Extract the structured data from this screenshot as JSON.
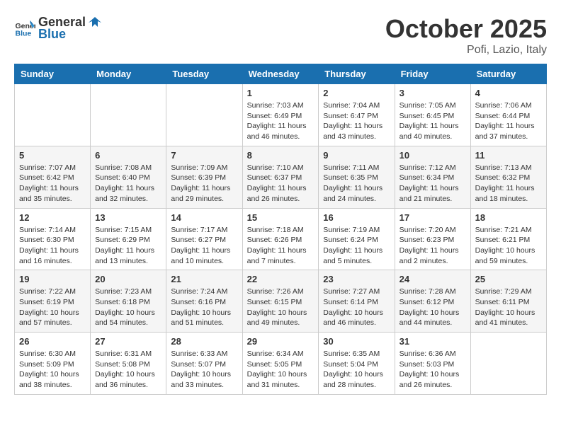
{
  "header": {
    "logo_general": "General",
    "logo_blue": "Blue",
    "month": "October 2025",
    "location": "Pofi, Lazio, Italy"
  },
  "weekdays": [
    "Sunday",
    "Monday",
    "Tuesday",
    "Wednesday",
    "Thursday",
    "Friday",
    "Saturday"
  ],
  "weeks": [
    [
      {
        "day": "",
        "info": ""
      },
      {
        "day": "",
        "info": ""
      },
      {
        "day": "",
        "info": ""
      },
      {
        "day": "1",
        "info": "Sunrise: 7:03 AM\nSunset: 6:49 PM\nDaylight: 11 hours and 46 minutes."
      },
      {
        "day": "2",
        "info": "Sunrise: 7:04 AM\nSunset: 6:47 PM\nDaylight: 11 hours and 43 minutes."
      },
      {
        "day": "3",
        "info": "Sunrise: 7:05 AM\nSunset: 6:45 PM\nDaylight: 11 hours and 40 minutes."
      },
      {
        "day": "4",
        "info": "Sunrise: 7:06 AM\nSunset: 6:44 PM\nDaylight: 11 hours and 37 minutes."
      }
    ],
    [
      {
        "day": "5",
        "info": "Sunrise: 7:07 AM\nSunset: 6:42 PM\nDaylight: 11 hours and 35 minutes."
      },
      {
        "day": "6",
        "info": "Sunrise: 7:08 AM\nSunset: 6:40 PM\nDaylight: 11 hours and 32 minutes."
      },
      {
        "day": "7",
        "info": "Sunrise: 7:09 AM\nSunset: 6:39 PM\nDaylight: 11 hours and 29 minutes."
      },
      {
        "day": "8",
        "info": "Sunrise: 7:10 AM\nSunset: 6:37 PM\nDaylight: 11 hours and 26 minutes."
      },
      {
        "day": "9",
        "info": "Sunrise: 7:11 AM\nSunset: 6:35 PM\nDaylight: 11 hours and 24 minutes."
      },
      {
        "day": "10",
        "info": "Sunrise: 7:12 AM\nSunset: 6:34 PM\nDaylight: 11 hours and 21 minutes."
      },
      {
        "day": "11",
        "info": "Sunrise: 7:13 AM\nSunset: 6:32 PM\nDaylight: 11 hours and 18 minutes."
      }
    ],
    [
      {
        "day": "12",
        "info": "Sunrise: 7:14 AM\nSunset: 6:30 PM\nDaylight: 11 hours and 16 minutes."
      },
      {
        "day": "13",
        "info": "Sunrise: 7:15 AM\nSunset: 6:29 PM\nDaylight: 11 hours and 13 minutes."
      },
      {
        "day": "14",
        "info": "Sunrise: 7:17 AM\nSunset: 6:27 PM\nDaylight: 11 hours and 10 minutes."
      },
      {
        "day": "15",
        "info": "Sunrise: 7:18 AM\nSunset: 6:26 PM\nDaylight: 11 hours and 7 minutes."
      },
      {
        "day": "16",
        "info": "Sunrise: 7:19 AM\nSunset: 6:24 PM\nDaylight: 11 hours and 5 minutes."
      },
      {
        "day": "17",
        "info": "Sunrise: 7:20 AM\nSunset: 6:23 PM\nDaylight: 11 hours and 2 minutes."
      },
      {
        "day": "18",
        "info": "Sunrise: 7:21 AM\nSunset: 6:21 PM\nDaylight: 10 hours and 59 minutes."
      }
    ],
    [
      {
        "day": "19",
        "info": "Sunrise: 7:22 AM\nSunset: 6:19 PM\nDaylight: 10 hours and 57 minutes."
      },
      {
        "day": "20",
        "info": "Sunrise: 7:23 AM\nSunset: 6:18 PM\nDaylight: 10 hours and 54 minutes."
      },
      {
        "day": "21",
        "info": "Sunrise: 7:24 AM\nSunset: 6:16 PM\nDaylight: 10 hours and 51 minutes."
      },
      {
        "day": "22",
        "info": "Sunrise: 7:26 AM\nSunset: 6:15 PM\nDaylight: 10 hours and 49 minutes."
      },
      {
        "day": "23",
        "info": "Sunrise: 7:27 AM\nSunset: 6:14 PM\nDaylight: 10 hours and 46 minutes."
      },
      {
        "day": "24",
        "info": "Sunrise: 7:28 AM\nSunset: 6:12 PM\nDaylight: 10 hours and 44 minutes."
      },
      {
        "day": "25",
        "info": "Sunrise: 7:29 AM\nSunset: 6:11 PM\nDaylight: 10 hours and 41 minutes."
      }
    ],
    [
      {
        "day": "26",
        "info": "Sunrise: 6:30 AM\nSunset: 5:09 PM\nDaylight: 10 hours and 38 minutes."
      },
      {
        "day": "27",
        "info": "Sunrise: 6:31 AM\nSunset: 5:08 PM\nDaylight: 10 hours and 36 minutes."
      },
      {
        "day": "28",
        "info": "Sunrise: 6:33 AM\nSunset: 5:07 PM\nDaylight: 10 hours and 33 minutes."
      },
      {
        "day": "29",
        "info": "Sunrise: 6:34 AM\nSunset: 5:05 PM\nDaylight: 10 hours and 31 minutes."
      },
      {
        "day": "30",
        "info": "Sunrise: 6:35 AM\nSunset: 5:04 PM\nDaylight: 10 hours and 28 minutes."
      },
      {
        "day": "31",
        "info": "Sunrise: 6:36 AM\nSunset: 5:03 PM\nDaylight: 10 hours and 26 minutes."
      },
      {
        "day": "",
        "info": ""
      }
    ]
  ]
}
